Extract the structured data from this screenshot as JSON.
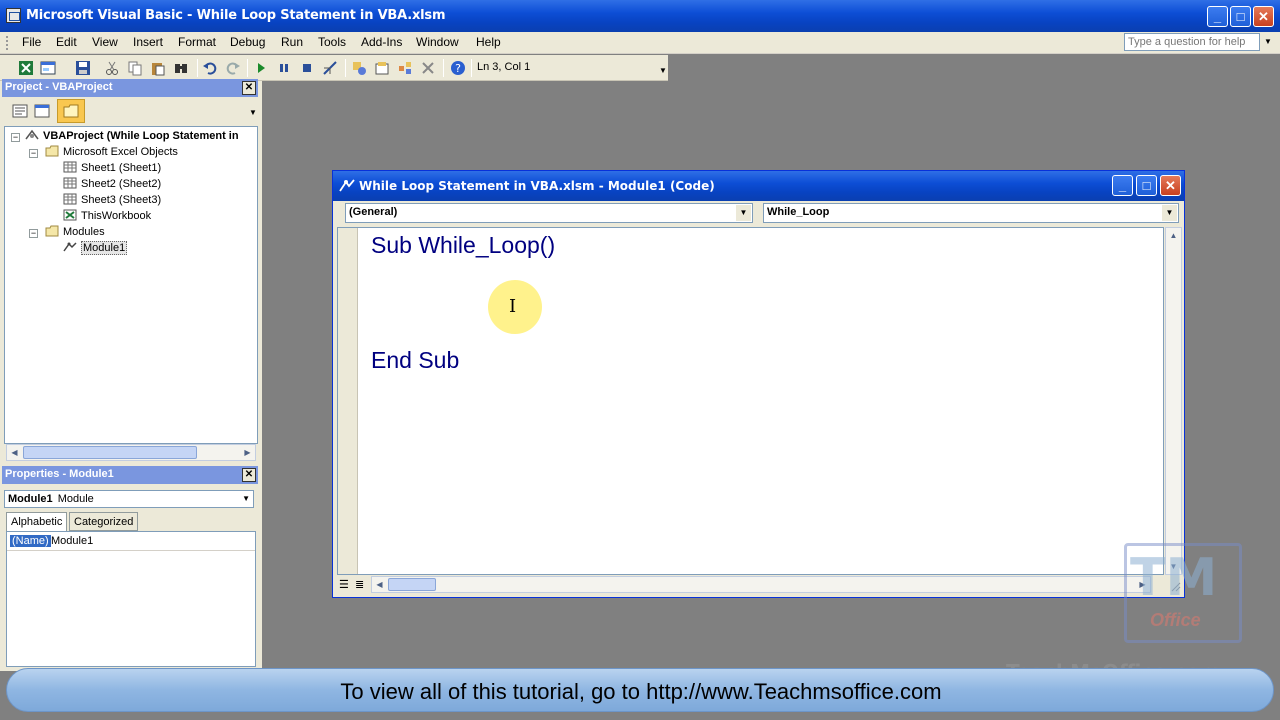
{
  "window": {
    "title": "Microsoft Visual Basic - While Loop Statement in VBA.xlsm"
  },
  "menu": [
    "File",
    "Edit",
    "View",
    "Insert",
    "Format",
    "Debug",
    "Run",
    "Tools",
    "Add-Ins",
    "Window",
    "Help"
  ],
  "ask_box": {
    "placeholder": "Type a question for help"
  },
  "toolbar": {
    "icons": [
      "excel-icon",
      "insert-userform-icon",
      "save-icon",
      "cut-icon",
      "copy-icon",
      "paste-icon",
      "find-icon",
      "undo-icon",
      "redo-icon",
      "run-icon",
      "break-icon",
      "reset-icon",
      "design-mode-icon",
      "project-explorer-icon",
      "properties-icon",
      "object-browser-icon",
      "toolbox-icon",
      "help-icon"
    ],
    "position": "Ln 3, Col 1"
  },
  "project_panel": {
    "title": "Project - VBAProject",
    "tree": {
      "root": "VBAProject (While Loop Statement in",
      "excel_objects": "Microsoft Excel Objects",
      "sheets": [
        "Sheet1 (Sheet1)",
        "Sheet2 (Sheet2)",
        "Sheet3 (Sheet3)",
        "ThisWorkbook"
      ],
      "modules_folder": "Modules",
      "module": "Module1"
    }
  },
  "properties_panel": {
    "title": "Properties - Module1",
    "object_name": "Module1",
    "object_type": "Module",
    "tabs": [
      "Alphabetic",
      "Categorized"
    ],
    "property_name": "(Name)",
    "property_value": "Module1"
  },
  "code_window": {
    "title": "While Loop Statement in VBA.xlsm - Module1 (Code)",
    "object_combo": "(General)",
    "procedure_combo": "While_Loop",
    "lines": [
      "Sub While_Loop()",
      "",
      "",
      "End Sub"
    ]
  },
  "watermark": {
    "logo": "TM",
    "brand": "Office",
    "url": "TeachMsOffice.com"
  },
  "banner": {
    "text": "To view all of this tutorial, go to http://www.Teachmsoffice.com"
  }
}
